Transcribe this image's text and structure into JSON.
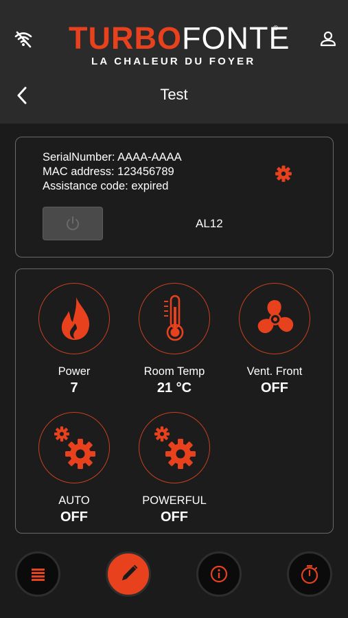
{
  "header": {
    "logo": {
      "part1": "TURBO",
      "part2": "FONTE",
      "reg": "®",
      "tagline": "LA CHALEUR DU FOYER"
    },
    "title": "Test",
    "icons": {
      "left": "wifi-off-icon",
      "right": "user-icon",
      "back": "chevron-left-icon"
    }
  },
  "device": {
    "serial": "SerialNumber: AAAA-AAAA",
    "mac": "MAC address: 123456789",
    "assistance": "Assistance code: expired",
    "name": "AL12",
    "settings_icon": "gear-icon",
    "power_icon": "power-icon"
  },
  "controls": [
    {
      "label": "Power",
      "value": "7",
      "icon": "flame-icon"
    },
    {
      "label": "Room Temp",
      "value": "21 °C",
      "icon": "thermometer-icon"
    },
    {
      "label": "Vent. Front",
      "value": "OFF",
      "icon": "fan-icon"
    },
    {
      "label": "AUTO",
      "value": "OFF",
      "icon": "gears-icon"
    },
    {
      "label": "POWERFUL",
      "value": "OFF",
      "icon": "gears-icon"
    }
  ],
  "bottom_nav": [
    {
      "icon": "list-icon",
      "active": false
    },
    {
      "icon": "pencil-icon",
      "active": true
    },
    {
      "icon": "info-icon",
      "active": false
    },
    {
      "icon": "timer-icon",
      "active": false
    }
  ],
  "colors": {
    "accent": "#e8411e",
    "header_bg": "#2b2b2b",
    "page_bg": "#1b1b1b",
    "card_border": "#6a6a6a"
  }
}
